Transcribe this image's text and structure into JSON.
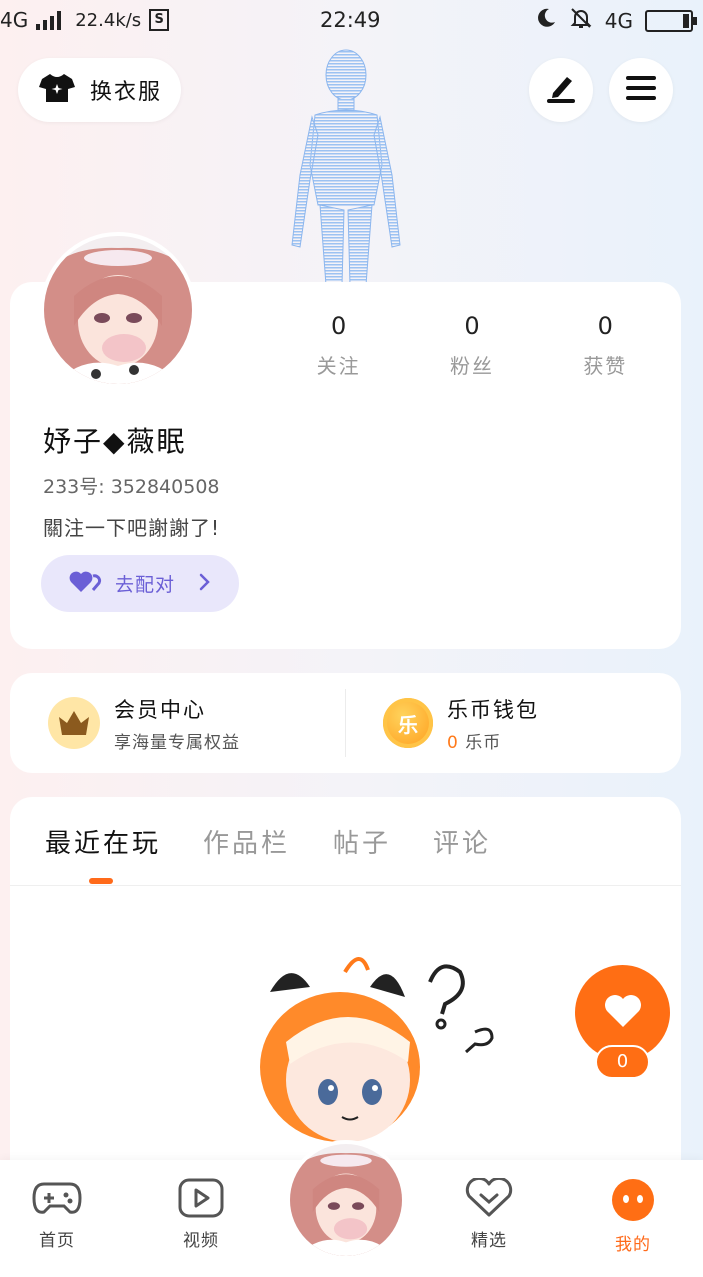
{
  "status_bar": {
    "network": "4G",
    "speed": "22.4k/s",
    "s_badge": "S",
    "time": "22:49",
    "network_right": "4G"
  },
  "header": {
    "outfit_label": "换衣服",
    "edit_icon": "edit-icon",
    "menu_icon": "menu-icon"
  },
  "profile": {
    "stats": [
      {
        "value": "0",
        "label": "关注"
      },
      {
        "value": "0",
        "label": "粉丝"
      },
      {
        "value": "0",
        "label": "获赞"
      }
    ],
    "nickname": "妤子◆薇眠",
    "uid": "233号: 352840508",
    "bio": "關注一下吧謝謝了!",
    "match_label": "去配对"
  },
  "member": {
    "title": "会员中心",
    "subtitle": "享海量专属权益"
  },
  "wallet": {
    "title": "乐币钱包",
    "coin_glyph": "乐",
    "amount": "0",
    "unit": "乐币"
  },
  "tabs": [
    "最近在玩",
    "作品栏",
    "帖子",
    "评论"
  ],
  "like": {
    "count": "0"
  },
  "bottom_nav": [
    {
      "label": "首页"
    },
    {
      "label": "视频"
    },
    {
      "label": "精选"
    },
    {
      "label": "我的"
    }
  ],
  "colors": {
    "accent": "#ff6e14",
    "match_bg": "#e9e7fb",
    "match_text": "#6b5fd6"
  }
}
